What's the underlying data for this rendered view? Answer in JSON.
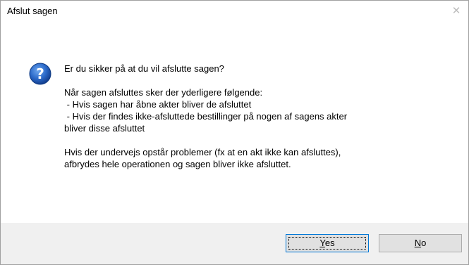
{
  "window": {
    "title": "Afslut sagen",
    "close_glyph": "✕"
  },
  "dialog": {
    "icon": "question-icon",
    "question": "Er du sikker på at du vil afslutte sagen?",
    "details_intro": "Når sagen afsluttes sker der yderligere følgende:",
    "details_line1": " - Hvis sagen har åbne akter bliver de afsluttet",
    "details_line2": " - Hvis der findes ikke-afsluttede bestillinger på nogen af sagens akter",
    "details_line3": "bliver disse afsluttet",
    "warning_line1": "Hvis der undervejs opstår problemer (fx at en akt ikke kan afsluttes),",
    "warning_line2": "afbrydes hele operationen og sagen bliver ikke afsluttet."
  },
  "buttons": {
    "yes_mnemonic": "Y",
    "yes_rest": "es",
    "no_mnemonic": "N",
    "no_rest": "o"
  },
  "colors": {
    "icon_blue": "#1e5bb8",
    "footer_bg": "#f0f0f0",
    "default_button_border": "#0078d7"
  }
}
